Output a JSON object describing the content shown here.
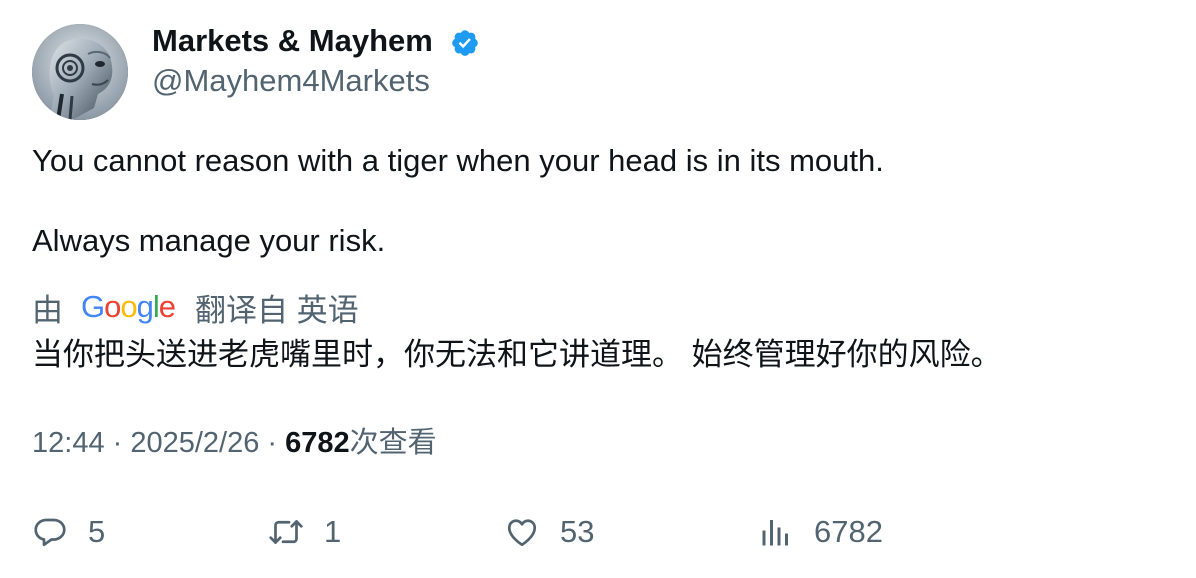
{
  "author": {
    "display_name": "Markets & Mayhem",
    "handle": "@Mayhem4Markets",
    "verified": true
  },
  "tweet": {
    "line1": "You cannot reason with a tiger when your head is in its mouth.",
    "line2": "Always manage your risk."
  },
  "translation": {
    "by_label": "由",
    "provider": "Google",
    "from_label": "翻译自 英语",
    "text": "当你把头送进老虎嘴里时，你无法和它讲道理。 始终管理好你的风险。"
  },
  "meta": {
    "time": "12:44",
    "separator": " · ",
    "date": "2025/2/26",
    "views_count": "6782",
    "views_label": "次查看"
  },
  "actions": {
    "reply_count": "5",
    "retweet_count": "1",
    "like_count": "53",
    "views_count": "6782"
  },
  "colors": {
    "text_primary": "#0f1419",
    "text_secondary": "#536471",
    "verified_blue": "#1d9bf0"
  }
}
